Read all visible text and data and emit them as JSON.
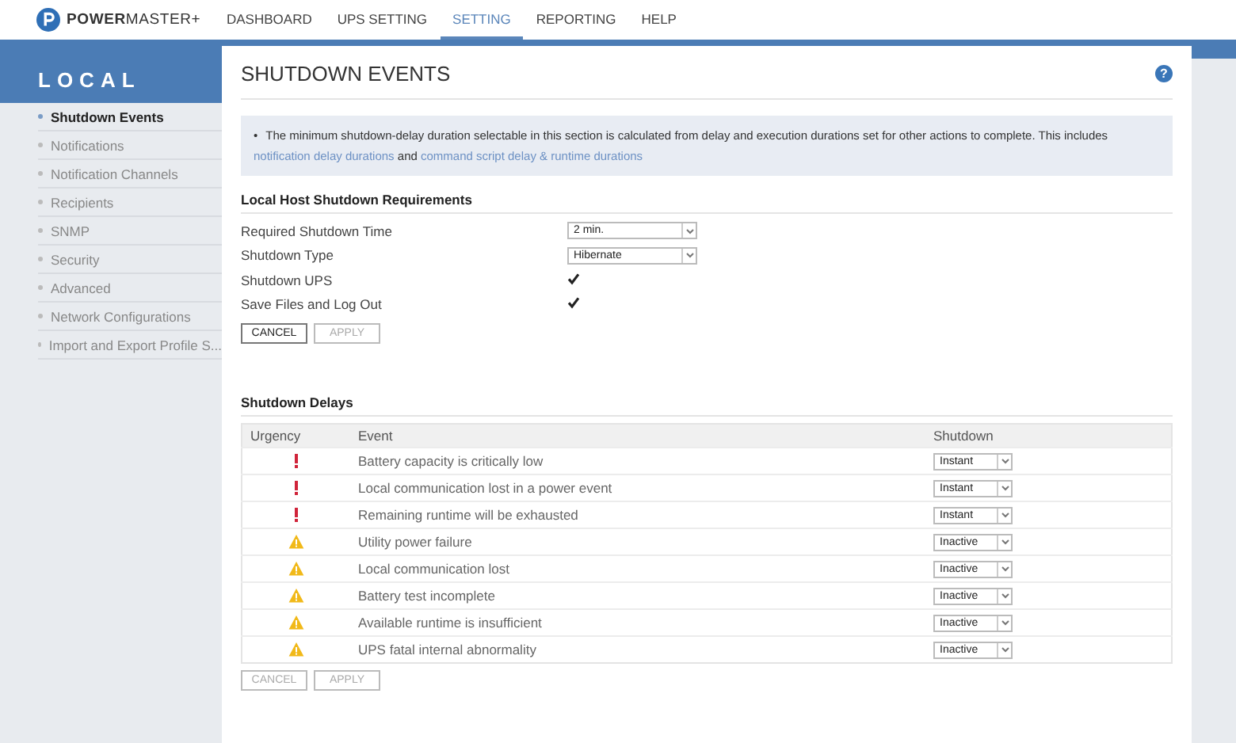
{
  "app": {
    "logo": "**POWER**MASTER+"
  },
  "nav": [
    {
      "label": "DASHBOARD",
      "selected": false
    },
    {
      "label": "UPS SETTING",
      "selected": false
    },
    {
      "label": "SETTING",
      "selected": true
    },
    {
      "label": "REPORTING",
      "selected": false
    },
    {
      "label": "HELP",
      "selected": false
    }
  ],
  "sidebar": {
    "title": "LOCAL",
    "items": [
      {
        "label": "Shutdown Events",
        "selected": true
      },
      {
        "label": "Notifications",
        "selected": false
      },
      {
        "label": "Notification Channels",
        "selected": false
      },
      {
        "label": "Recipients",
        "selected": false
      },
      {
        "label": "SNMP",
        "selected": false
      },
      {
        "label": "Security",
        "selected": false
      },
      {
        "label": "Advanced",
        "selected": false
      },
      {
        "label": "Network Configurations",
        "selected": false
      },
      {
        "label": "Import and Export Profile S...",
        "selected": false
      }
    ]
  },
  "page": {
    "title": "SHUTDOWN EVENTS",
    "help": "?"
  },
  "note": {
    "bullet": "•",
    "text": "The minimum shutdown-delay duration selectable in this section is calculated from delay and execution durations set for other actions to complete. This includes",
    "link1": "notification delay durations",
    "joiner": "and",
    "link2": "command script delay & runtime durations"
  },
  "requirements": {
    "title": "Local Host Shutdown Requirements",
    "fields": [
      {
        "kind": "select",
        "label": "Required Shutdown Time",
        "value": "2 min."
      },
      {
        "kind": "select",
        "label": "Shutdown Type",
        "value": "Hibernate"
      },
      {
        "kind": "checkbox",
        "label": "Shutdown UPS",
        "checked": true
      },
      {
        "kind": "checkbox",
        "label": "Save Files and Log Out",
        "checked": true
      }
    ],
    "buttons": [
      {
        "label": "CANCEL",
        "disabled": false
      },
      {
        "label": "APPLY",
        "disabled": true
      }
    ]
  },
  "delays": {
    "title": "Shutdown Delays",
    "columns": [
      "Urgency",
      "Event",
      "Shutdown"
    ],
    "rows": [
      {
        "kind": "critical",
        "event": "Battery capacity is critically low",
        "shutdown": "Instant"
      },
      {
        "kind": "critical",
        "event": "Local communication lost in a power event",
        "shutdown": "Instant"
      },
      {
        "kind": "critical",
        "event": "Remaining runtime will be exhausted",
        "shutdown": "Instant"
      },
      {
        "kind": "warning",
        "event": "Utility power failure",
        "shutdown": "Inactive"
      },
      {
        "kind": "warning",
        "event": "Local communication lost",
        "shutdown": "Inactive"
      },
      {
        "kind": "warning",
        "event": "Battery test incomplete",
        "shutdown": "Inactive"
      },
      {
        "kind": "warning",
        "event": "Available runtime is insufficient",
        "shutdown": "Inactive"
      },
      {
        "kind": "warning",
        "event": "UPS fatal internal abnormality",
        "shutdown": "Inactive"
      }
    ],
    "buttons": [
      {
        "label": "CANCEL",
        "disabled": true
      },
      {
        "label": "APPLY",
        "disabled": true
      }
    ]
  }
}
